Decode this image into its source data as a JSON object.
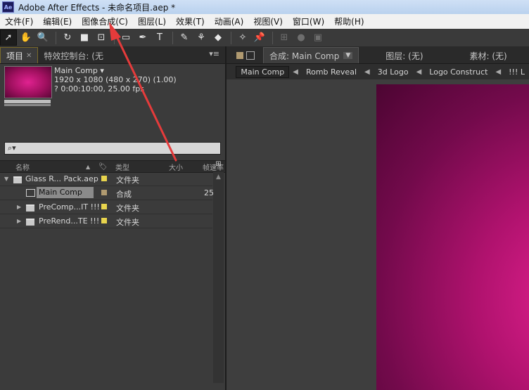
{
  "window": {
    "title": "Adobe After Effects - 未命名项目.aep *",
    "logo_text": "Ae"
  },
  "menu": [
    "文件(F)",
    "编辑(E)",
    "图像合成(C)",
    "图层(L)",
    "效果(T)",
    "动画(A)",
    "视图(V)",
    "窗口(W)",
    "帮助(H)"
  ],
  "toolbar": {
    "tools": [
      "selection-icon",
      "hand-icon",
      "zoom-icon",
      "rotate-icon",
      "camera-icon",
      "pan-behind-icon",
      "rectangle-icon",
      "pen-icon",
      "text-icon",
      "brush-icon",
      "clone-stamp-icon",
      "eraser-icon",
      "roto-brush-icon",
      "puppet-pin-icon"
    ],
    "glyphs": [
      "➚",
      "✋",
      "🔍",
      "↻",
      "■",
      "⊡",
      "▭",
      "✒",
      "T",
      "✎",
      "⚘",
      "◆",
      "✧",
      "📌"
    ]
  },
  "project_panel": {
    "tab_project": "项目",
    "tab_effects": "特效控制台: (无",
    "comp_name": "Main Comp ▾",
    "comp_size": "1920 x 1080  (480 x 270) (1.00)",
    "comp_duration": "? 0:00:10:00, 25.00 fps",
    "search_placeholder": "⌕▾",
    "columns": {
      "name": "名称",
      "type": "类型",
      "size": "大小",
      "rate": "帧速率"
    },
    "items": [
      {
        "name": "Glass R... Pack.aep",
        "type": "文件夹",
        "size": "",
        "color": "#e8d44d",
        "kind": "folder",
        "expanded": true,
        "indent": 0
      },
      {
        "name": "Main Comp",
        "type": "合成",
        "size": "25",
        "color": "#b09a70",
        "kind": "comp",
        "selected": true,
        "indent": 1
      },
      {
        "name": "PreComp...IT !!!",
        "type": "文件夹",
        "size": "",
        "color": "#e8d44d",
        "kind": "folder",
        "indent": 1
      },
      {
        "name": "PreRend...TE !!!",
        "type": "文件夹",
        "size": "",
        "color": "#e8d44d",
        "kind": "folder",
        "indent": 1
      }
    ]
  },
  "viewer": {
    "tab_comp": "合成: Main Comp",
    "tab_layer": "图层: (无)",
    "tab_footage": "素材: (无)",
    "flow": [
      "Main Comp",
      "Romb Reveal",
      "3d Logo",
      "Logo Construct",
      "!!! L"
    ],
    "colors": {
      "canvas_center": "#e3218f",
      "canvas_edge": "#4c0532"
    }
  },
  "annotation": {
    "color": "#e53b3b",
    "target": "图像合成(C)"
  }
}
